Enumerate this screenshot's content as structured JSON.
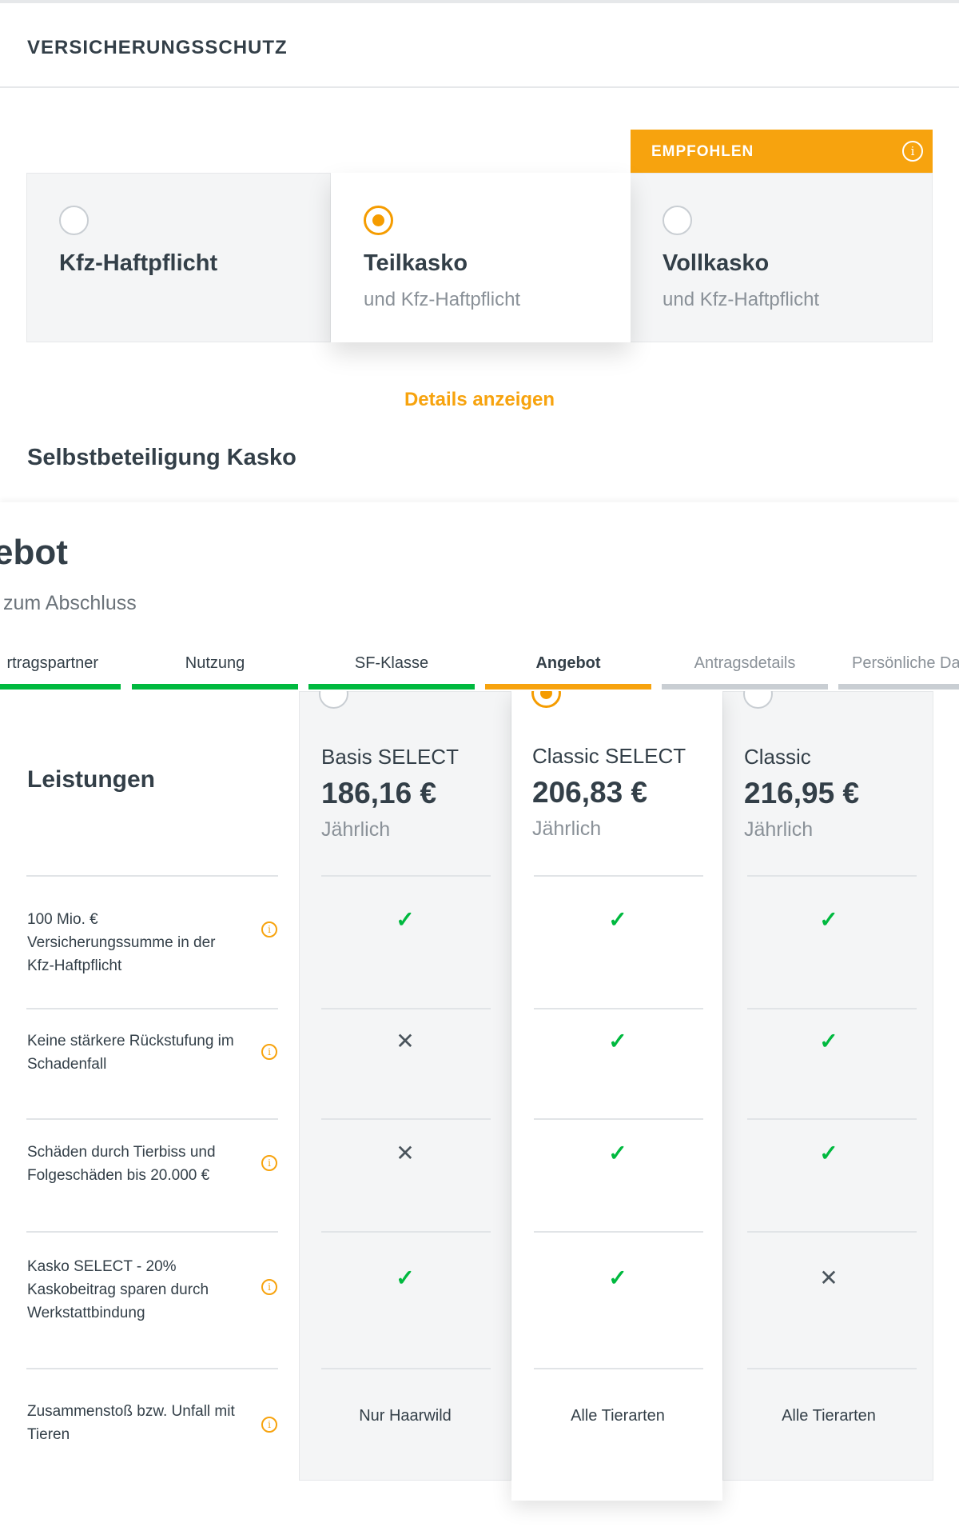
{
  "section": {
    "title": "VERSICHERUNGSSCHUTZ"
  },
  "coverage": {
    "badge": {
      "label": "EMPFOHLEN",
      "icon": "info-icon"
    },
    "options": [
      {
        "title": "Kfz-Haftpflicht",
        "subtitle": "",
        "selected": false
      },
      {
        "title": "Teilkasko",
        "subtitle": "und Kfz-Haftpflicht",
        "selected": true
      },
      {
        "title": "Vollkasko",
        "subtitle": "und Kfz-Haftpflicht",
        "selected": false
      }
    ],
    "details_link": "Details anzeigen",
    "deductible_heading": "Selbstbeteiligung Kasko"
  },
  "overlay": {
    "heading": "ebot",
    "subheading": "zum Abschluss",
    "steps": [
      {
        "label": "rtragspartner",
        "state": "done"
      },
      {
        "label": "Nutzung",
        "state": "done"
      },
      {
        "label": "SF-Klasse",
        "state": "done"
      },
      {
        "label": "Angebot",
        "state": "active"
      },
      {
        "label": "Antragsdetails",
        "state": "pending"
      },
      {
        "label": "Persönliche Da",
        "state": "pending"
      }
    ]
  },
  "tariffs": {
    "features_title": "Leistungen",
    "columns": [
      {
        "name": "Basis SELECT",
        "price": "186,16 €",
        "period": "Jährlich",
        "selected": false
      },
      {
        "name": "Classic SELECT",
        "price": "206,83 €",
        "period": "Jährlich",
        "selected": true
      },
      {
        "name": "Classic",
        "price": "216,95 €",
        "period": "Jährlich",
        "selected": false
      }
    ],
    "features": [
      {
        "label": "100 Mio. € Versicherungssumme in der Kfz-Haftpflicht",
        "values": [
          "check",
          "check",
          "check"
        ]
      },
      {
        "label": "Keine stärkere Rückstufung im Schadenfall",
        "values": [
          "cross",
          "check",
          "check"
        ]
      },
      {
        "label": "Schäden durch Tierbiss und Folgeschäden bis 20.000 €",
        "values": [
          "cross",
          "check",
          "check"
        ]
      },
      {
        "label": "Kasko SELECT - 20% Kaskobeitrag sparen durch Werkstattbindung",
        "values": [
          "check",
          "check",
          "cross"
        ]
      },
      {
        "label": "Zusammenstoß bzw. Unfall mit Tieren",
        "values": [
          "Nur Haarwild",
          "Alle Tierarten",
          "Alle Tierarten"
        ]
      }
    ],
    "symbols": {
      "check": "✓",
      "cross": "✕"
    }
  },
  "colors": {
    "accent": "#f7a30e",
    "success": "#00b93f",
    "text": "#333f48",
    "muted": "#8a9198"
  }
}
